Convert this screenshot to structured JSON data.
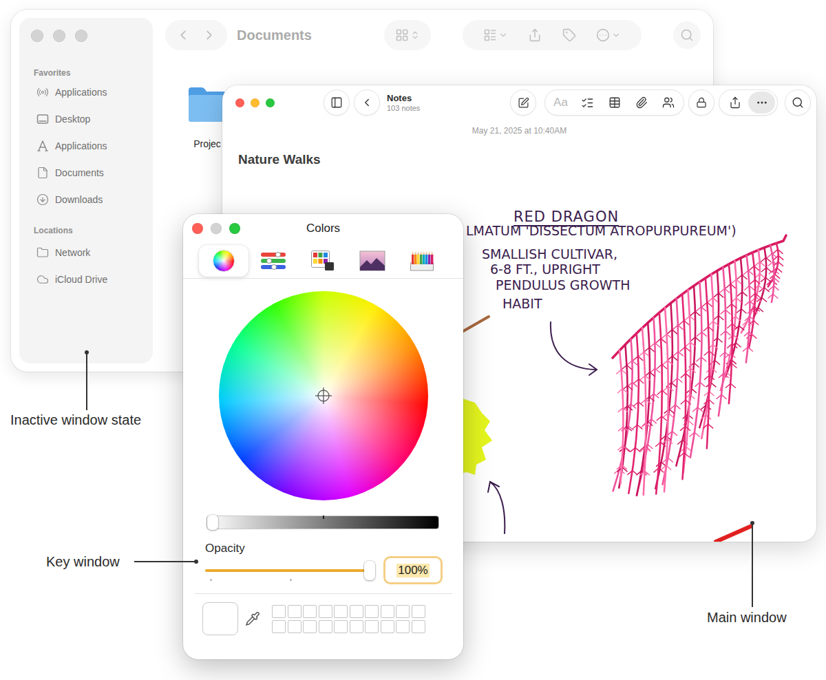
{
  "callouts": {
    "inactive_window": {
      "label": "Inactive window state"
    },
    "key_window": {
      "label": "Key window"
    },
    "main_window": {
      "label": "Main window"
    }
  },
  "finder_window": {
    "active": false,
    "controls": [
      {
        "kind": "close",
        "enabled": false
      },
      {
        "kind": "minimize",
        "enabled": false
      },
      {
        "kind": "zoom",
        "enabled": false
      }
    ],
    "title": "Documents",
    "sidebar": {
      "sections": [
        {
          "heading": "Favorites",
          "items": [
            {
              "label": "Applications",
              "selected": false
            },
            {
              "label": "Desktop",
              "selected": false
            },
            {
              "label": "Applications",
              "selected": false
            },
            {
              "label": "Documents",
              "selected": false
            },
            {
              "label": "Downloads",
              "selected": false
            }
          ]
        },
        {
          "heading": "Locations",
          "items": [
            {
              "label": "Network",
              "selected": false
            },
            {
              "label": "iCloud Drive",
              "selected": false
            }
          ]
        }
      ]
    },
    "files": [
      {
        "name": "Projec",
        "selected": false
      }
    ]
  },
  "notes_window": {
    "active": true,
    "controls": [
      {
        "kind": "close",
        "enabled": true
      },
      {
        "kind": "minimize",
        "enabled": true
      },
      {
        "kind": "zoom",
        "enabled": true
      }
    ],
    "folder": "Notes",
    "count": "103 notes",
    "format_button": {
      "label": "Aa",
      "disabled": true
    },
    "more_button": {
      "selected": true
    },
    "date": "May 21, 2025 at 10:40AM",
    "note": {
      "title": "Nature Walks",
      "sketch": {
        "heading": "RED DRAGON",
        "lines": [
          "LMATUM 'DISSECTUM ATROPURPUREUM')",
          "SMALLISH CULTIVAR,",
          "6-8 FT., UPRIGHT",
          "PENDULUS GROWTH",
          "HABIT"
        ]
      }
    }
  },
  "colors_window": {
    "active": true,
    "title": "Colors",
    "controls": [
      {
        "kind": "close",
        "enabled": true
      },
      {
        "kind": "minimize",
        "enabled": false
      },
      {
        "kind": "zoom",
        "enabled": true
      }
    ],
    "modes": [
      {
        "kind": "wheel",
        "selected": true
      },
      {
        "kind": "sliders",
        "selected": false
      },
      {
        "kind": "palettes",
        "selected": false
      },
      {
        "kind": "image",
        "selected": false
      },
      {
        "kind": "pencils",
        "selected": false
      }
    ],
    "brightness": {
      "level": 0
    },
    "opacity": {
      "label": "Opacity",
      "level": 1,
      "value": "100%",
      "focused": true
    },
    "swatches": [
      {
        "filled": false
      },
      {
        "filled": false
      },
      {
        "filled": false
      },
      {
        "filled": false
      },
      {
        "filled": false
      },
      {
        "filled": false
      },
      {
        "filled": false
      },
      {
        "filled": false
      },
      {
        "filled": false
      },
      {
        "filled": false
      },
      {
        "filled": false
      },
      {
        "filled": false
      },
      {
        "filled": false
      },
      {
        "filled": false
      },
      {
        "filled": false
      },
      {
        "filled": false
      },
      {
        "filled": false
      },
      {
        "filled": false
      },
      {
        "filled": false
      },
      {
        "filled": false
      }
    ]
  }
}
